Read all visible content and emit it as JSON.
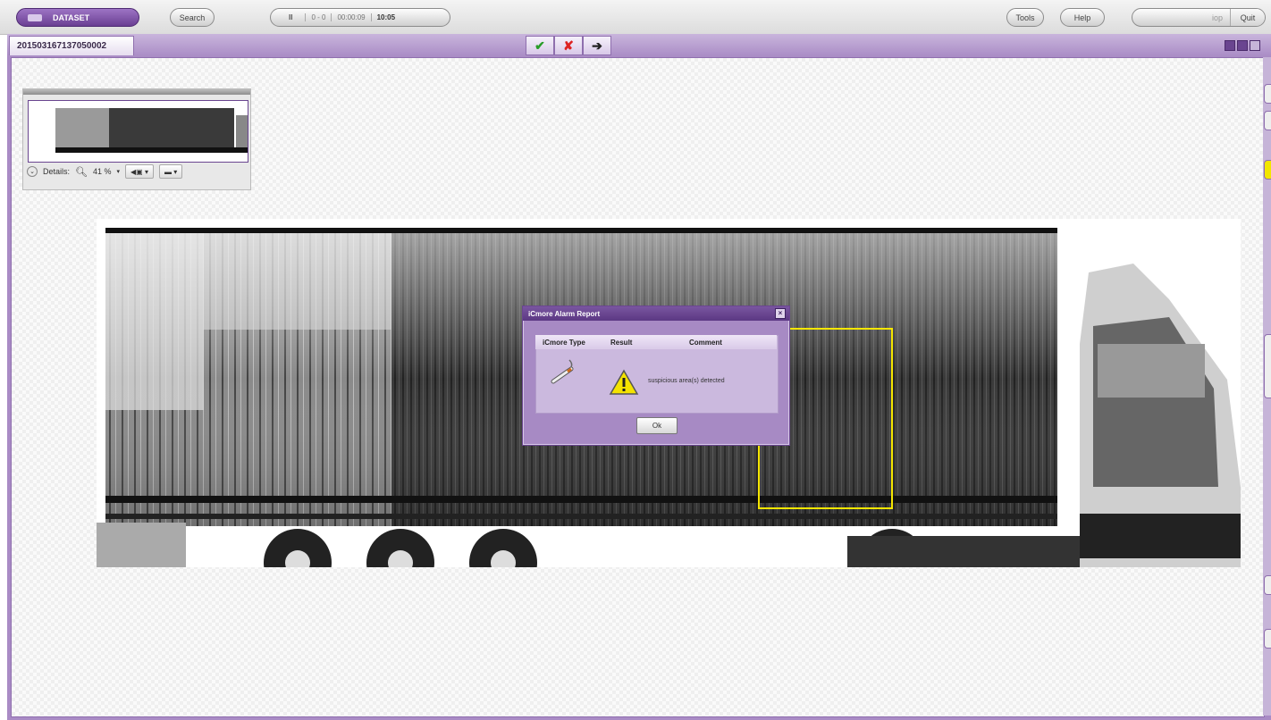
{
  "toolbar": {
    "dataset_label": "DATASET",
    "search_label": "Search",
    "pause_symbol": "II",
    "progress_text": "0 - 0",
    "elapsed_time": "00:00:09",
    "clock_time": "10:05",
    "tools_label": "Tools",
    "help_label": "Help",
    "user_label": "iop",
    "quit_label": "Quit"
  },
  "tab": {
    "scan_id": "201503167137050002"
  },
  "actions": {
    "accept_symbol": "✔",
    "reject_symbol": "✘",
    "next_symbol": "➔",
    "accept_color": "#2a9d2a",
    "reject_color": "#d22"
  },
  "overview": {
    "details_label": "Details:",
    "zoom_value": "41 %",
    "zoom_icon": "magnifier-icon"
  },
  "dialog": {
    "title": "iCmore Alarm Report",
    "columns": {
      "type": "iCmore Type",
      "result": "Result",
      "comment": "Comment"
    },
    "comment_text": "suspicious area(s) detected",
    "ok_label": "Ok",
    "type_icon": "cigarette-icon",
    "result_icon": "warning-triangle-icon"
  },
  "colors": {
    "brand_purple": "#6a3f93",
    "frame_purple": "#a98bc5",
    "detect_box": "#f5e600"
  }
}
